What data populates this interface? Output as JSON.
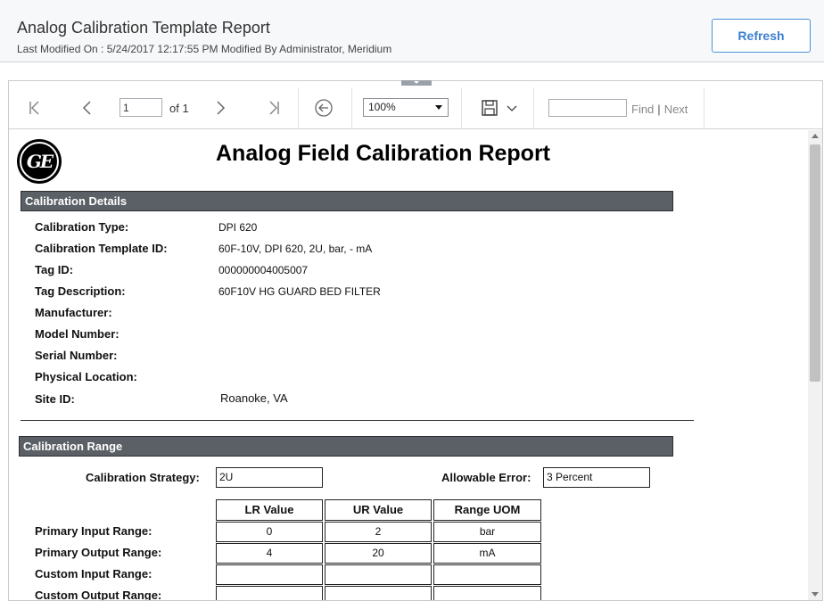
{
  "header": {
    "title": "Analog Calibration Template Report",
    "subtitle": "Last Modified On : 5/24/2017 12:17:55 PM Modified By Administrator, Meridium",
    "refresh_label": "Refresh"
  },
  "toolbar": {
    "page_value": "1",
    "of_label": "of 1",
    "zoom_value": "100%",
    "find_label": "Find",
    "find_sep": "|",
    "next_label": "Next"
  },
  "report": {
    "logo_text": "GE",
    "title": "Analog Field Calibration Report",
    "details_section": "Calibration Details",
    "details": [
      {
        "label": "Calibration Type:",
        "value": "DPI 620"
      },
      {
        "label": "Calibration Template ID:",
        "value": "60F-10V, DPI 620, 2U, bar,  - mA"
      },
      {
        "label": "Tag ID:",
        "value": "000000004005007"
      },
      {
        "label": "Tag Description:",
        "value": "60F10V HG GUARD BED FILTER"
      },
      {
        "label": "Manufacturer:",
        "value": ""
      },
      {
        "label": "Model Number:",
        "value": ""
      },
      {
        "label": "Serial Number:",
        "value": ""
      },
      {
        "label": "Physical Location:",
        "value": ""
      },
      {
        "label": "Site ID:",
        "value": "Roanoke, VA"
      }
    ],
    "range_section": "Calibration Range",
    "strategy_label": "Calibration Strategy:",
    "strategy_value": "2U",
    "allowable_label": "Allowable Error:",
    "allowable_value": "3 Percent",
    "columns": [
      "LR Value",
      "UR Value",
      "Range UOM"
    ],
    "rows": [
      {
        "label": "Primary Input Range:",
        "cells": [
          "0",
          "2",
          "bar"
        ]
      },
      {
        "label": "Primary Output Range:",
        "cells": [
          "4",
          "20",
          "mA"
        ]
      },
      {
        "label": "Custom Input Range:",
        "cells": [
          "",
          "",
          ""
        ]
      },
      {
        "label": "Custom Output Range:",
        "cells": [
          "",
          "",
          ""
        ]
      }
    ]
  }
}
